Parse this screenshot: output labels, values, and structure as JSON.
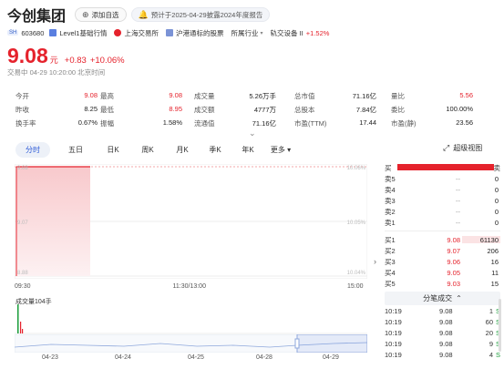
{
  "header": {
    "title": "今创集团",
    "add_watch": "添加自选",
    "notice": "预计于2025-04-29披露2024年度报告"
  },
  "tags": {
    "market": "SH",
    "code": "603680",
    "level": "Level1基础行情",
    "exchange": "上海交易所",
    "connect": "沪港通标的股票",
    "industry_label": "所属行业",
    "industry": "轨交设备 II",
    "industry_change": "+1.52%"
  },
  "quote": {
    "price": "9.08",
    "unit": "元",
    "change": "+0.83",
    "change_pct": "+10.06%",
    "status": "交易中 04-29 10:20:00 北京时间"
  },
  "stats": [
    [
      {
        "k": "今开",
        "v": "9.08",
        "c": "red"
      },
      {
        "k": "最高",
        "v": "9.08",
        "c": "red"
      },
      {
        "k": "成交量",
        "v": "5.26万手",
        "c": ""
      },
      {
        "k": "总市值",
        "v": "71.16亿",
        "c": ""
      },
      {
        "k": "量比",
        "v": "5.56",
        "c": "red"
      }
    ],
    [
      {
        "k": "昨收",
        "v": "8.25",
        "c": ""
      },
      {
        "k": "最低",
        "v": "8.95",
        "c": "red"
      },
      {
        "k": "成交额",
        "v": "4777万",
        "c": ""
      },
      {
        "k": "总股本",
        "v": "7.84亿",
        "c": ""
      },
      {
        "k": "委比",
        "v": "100.00%",
        "c": ""
      }
    ],
    [
      {
        "k": "换手率",
        "v": "0.67%",
        "c": ""
      },
      {
        "k": "振幅",
        "v": "1.58%",
        "c": ""
      },
      {
        "k": "流通值",
        "v": "71.16亿",
        "c": ""
      },
      {
        "k": "市盈(TTM)",
        "v": "17.44",
        "c": ""
      },
      {
        "k": "市盈(静)",
        "v": "23.56",
        "c": ""
      }
    ]
  ],
  "tabs": [
    "分时",
    "五日",
    "日K",
    "周K",
    "月K",
    "季K",
    "年K",
    "更多"
  ],
  "big_chart": "超级视图",
  "chart_data": {
    "type": "line",
    "left_ticks": [
      "9.08",
      "9.07",
      "8.88"
    ],
    "right_ticks": [
      "10.06%",
      "10.05%",
      "10.04%"
    ],
    "time_ticks": [
      "09:30",
      "11:30/13:00",
      "15:00"
    ],
    "series": [
      {
        "name": "",
        "values": [
          9.08,
          9.08
        ]
      }
    ],
    "volume_label": "成交量104手",
    "dates": [
      "04-23",
      "04-24",
      "04-25",
      "04-28",
      "04-29"
    ]
  },
  "book": {
    "buy_label": "买",
    "sell_label": "卖",
    "asks": [
      {
        "l": "卖5",
        "p": "--",
        "q": "0"
      },
      {
        "l": "卖4",
        "p": "--",
        "q": "0"
      },
      {
        "l": "卖3",
        "p": "--",
        "q": "0"
      },
      {
        "l": "卖2",
        "p": "--",
        "q": "0"
      },
      {
        "l": "卖1",
        "p": "--",
        "q": "0"
      }
    ],
    "bids": [
      {
        "l": "买1",
        "p": "9.08",
        "q": "61130"
      },
      {
        "l": "买2",
        "p": "9.07",
        "q": "206"
      },
      {
        "l": "买3",
        "p": "9.06",
        "q": "16"
      },
      {
        "l": "买4",
        "p": "9.05",
        "q": "11"
      },
      {
        "l": "买5",
        "p": "9.03",
        "q": "15"
      }
    ],
    "ticks_title": "分笔成交",
    "ticks": [
      {
        "t": "10:19",
        "p": "9.08",
        "q": "1",
        "d": "S"
      },
      {
        "t": "10:19",
        "p": "9.08",
        "q": "60",
        "d": "S"
      },
      {
        "t": "10:19",
        "p": "9.08",
        "q": "20",
        "d": "S"
      },
      {
        "t": "10:19",
        "p": "9.08",
        "q": "9",
        "d": "S"
      },
      {
        "t": "10:19",
        "p": "9.08",
        "q": "4",
        "d": "S"
      }
    ]
  }
}
